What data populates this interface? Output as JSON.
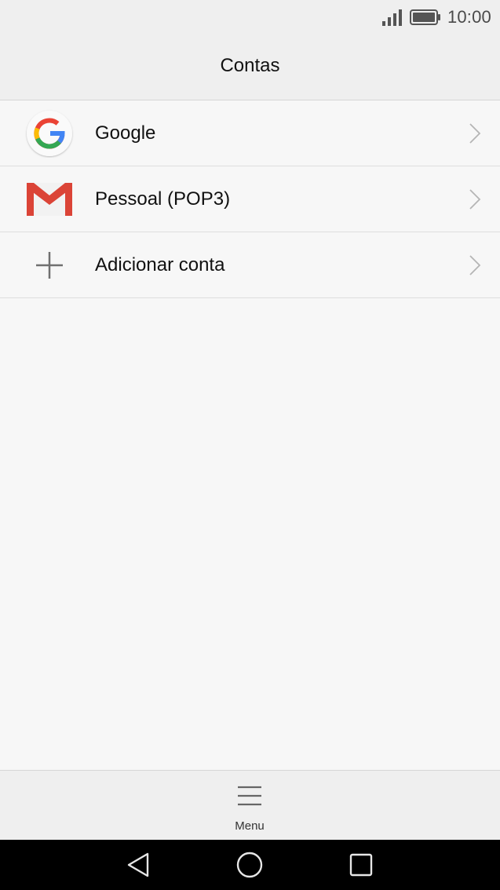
{
  "status_bar": {
    "time": "10:00",
    "signal_icon": "signal-icon",
    "battery_icon": "battery-icon"
  },
  "header": {
    "title": "Contas"
  },
  "accounts": [
    {
      "label": "Google",
      "icon": "google-icon"
    },
    {
      "label": "Pessoal (POP3)",
      "icon": "gmail-icon"
    },
    {
      "label": "Adicionar conta",
      "icon": "plus-icon"
    }
  ],
  "bottom_bar": {
    "menu_label": "Menu",
    "menu_icon": "hamburger-icon"
  },
  "nav_bar": {
    "back_icon": "back-icon",
    "home_icon": "home-icon",
    "recents_icon": "recents-icon"
  },
  "colors": {
    "google_blue": "#4285F4",
    "google_red": "#EA4335",
    "google_yellow": "#FBBC05",
    "google_green": "#34A853",
    "gmail_red": "#DB4437"
  }
}
